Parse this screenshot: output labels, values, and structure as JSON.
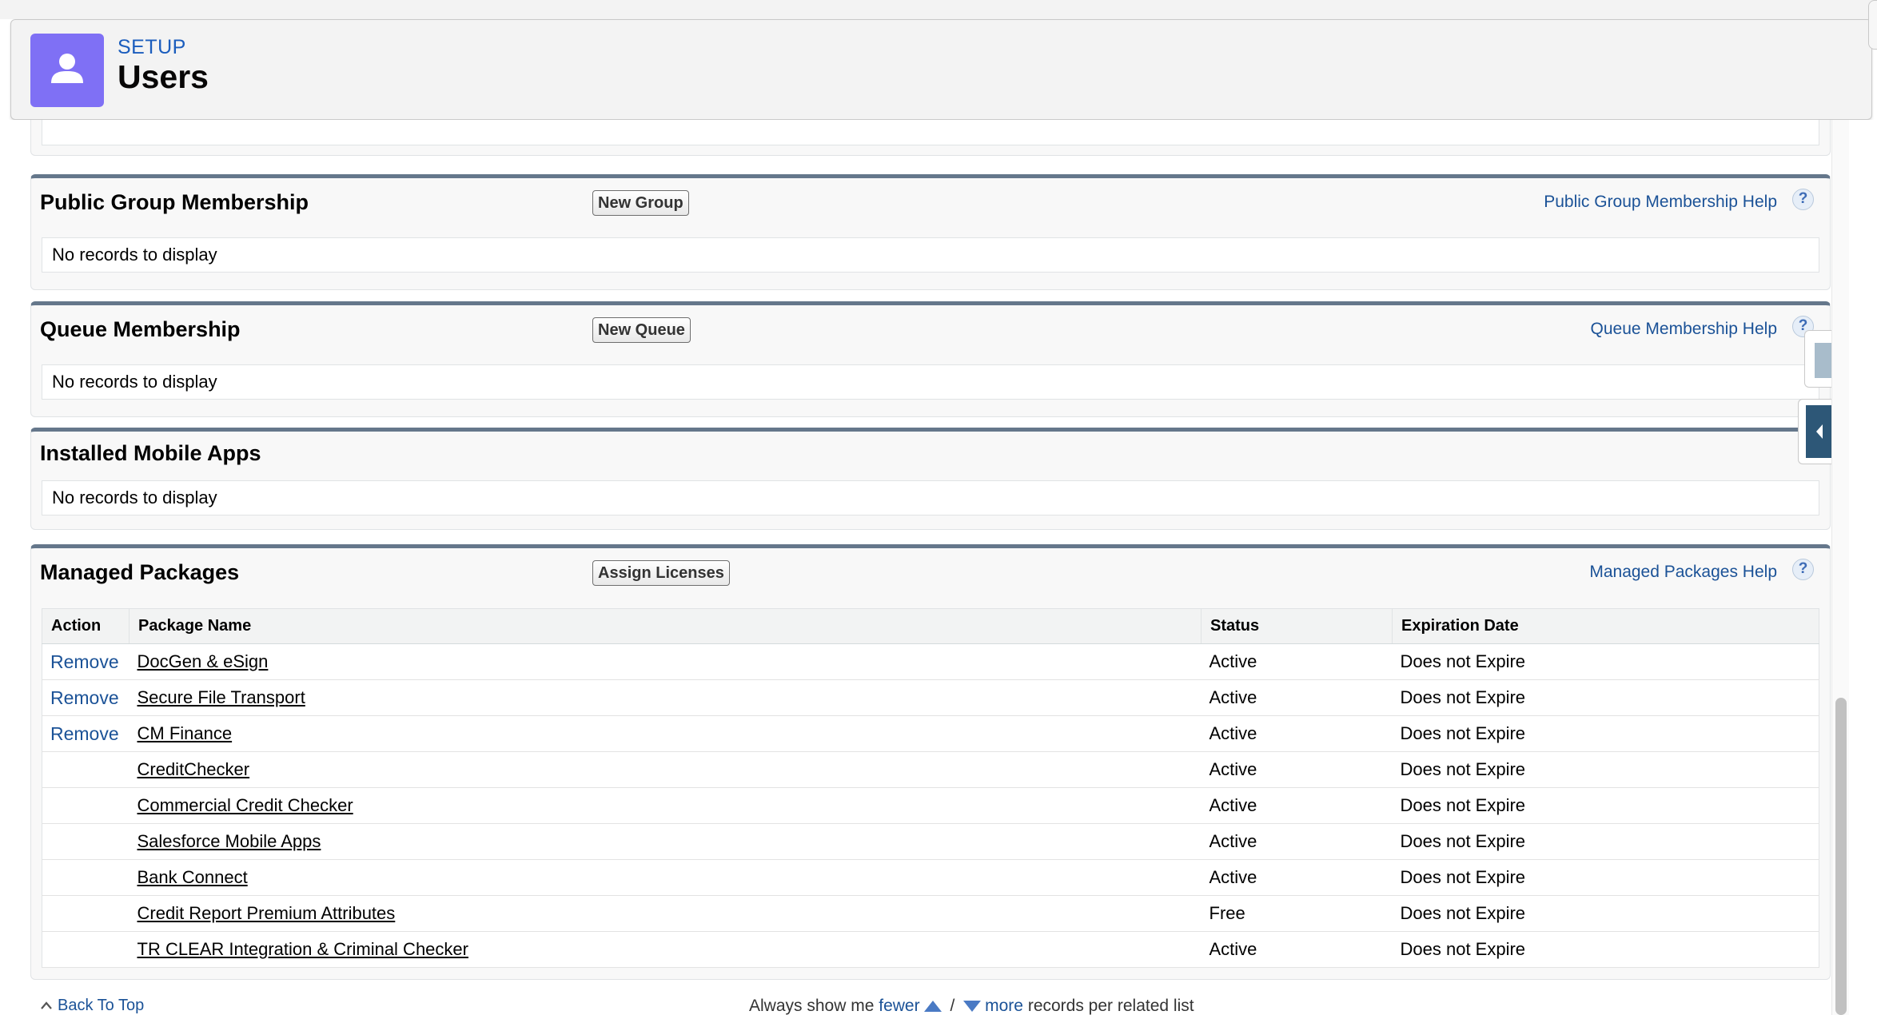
{
  "header": {
    "eyebrow": "SETUP",
    "title": "Users",
    "icon": "user-icon",
    "icon_color": "#7f70f5"
  },
  "sections": {
    "public_group": {
      "title": "Public Group Membership",
      "button": "New Group",
      "help": "Public Group Membership Help",
      "empty": "No records to display"
    },
    "queue": {
      "title": "Queue Membership",
      "button": "New Queue",
      "help": "Queue Membership Help",
      "empty": "No records to display"
    },
    "mobile_apps": {
      "title": "Installed Mobile Apps",
      "empty": "No records to display"
    },
    "managed_packages": {
      "title": "Managed Packages",
      "button": "Assign Licenses",
      "help": "Managed Packages Help",
      "columns": [
        "Action",
        "Package Name",
        "Status",
        "Expiration Date"
      ],
      "rows": [
        {
          "action": "Remove",
          "name": "DocGen & eSign",
          "status": "Active",
          "expiration": "Does not Expire"
        },
        {
          "action": "Remove",
          "name": "Secure File Transport",
          "status": "Active",
          "expiration": "Does not Expire"
        },
        {
          "action": "Remove",
          "name": "CM Finance",
          "status": "Active",
          "expiration": "Does not Expire"
        },
        {
          "action": "",
          "name": "CreditChecker",
          "status": "Active",
          "expiration": "Does not Expire"
        },
        {
          "action": "",
          "name": "Commercial Credit Checker",
          "status": "Active",
          "expiration": "Does not Expire"
        },
        {
          "action": "",
          "name": "Salesforce Mobile Apps",
          "status": "Active",
          "expiration": "Does not Expire"
        },
        {
          "action": "",
          "name": "Bank Connect",
          "status": "Active",
          "expiration": "Does not Expire"
        },
        {
          "action": "",
          "name": "Credit Report Premium Attributes",
          "status": "Free",
          "expiration": "Does not Expire"
        },
        {
          "action": "",
          "name": "TR CLEAR Integration & Criminal Checker",
          "status": "Active",
          "expiration": "Does not Expire"
        }
      ]
    }
  },
  "help_icon_glyph": "?",
  "footer": {
    "back_to_top": "Back To Top",
    "pref_prefix": "Always show me",
    "fewer": "fewer",
    "separator": "/",
    "more": "more",
    "pref_suffix": "records per related list"
  },
  "colors": {
    "link": "#1b5297",
    "section_border_top": "#65778b",
    "section_bg": "#f8f8f8"
  }
}
